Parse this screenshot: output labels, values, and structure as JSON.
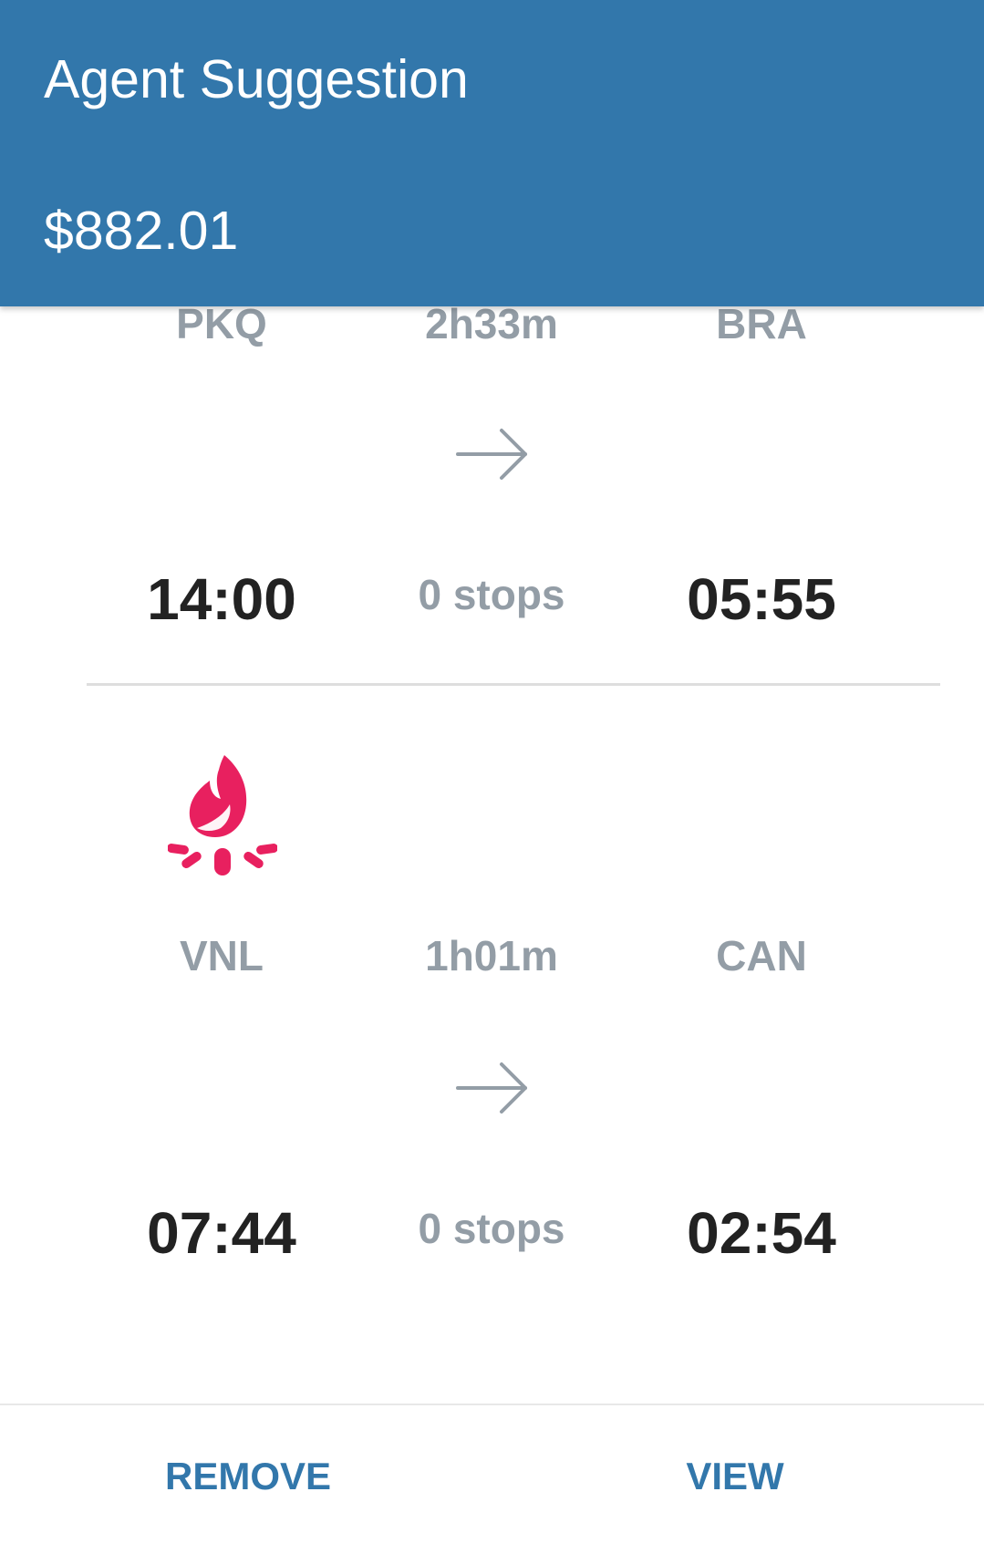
{
  "header": {
    "title": "Agent Suggestion",
    "price": "$882.01"
  },
  "legs": [
    {
      "origin": "PKQ",
      "duration": "2h33m",
      "destination": "BRA",
      "depart_time": "14:00",
      "stops": "0 stops",
      "arrive_time": "05:55",
      "arrow_icon": "arrow-right-icon"
    },
    {
      "airline_icon": "campfire-icon",
      "origin": "VNL",
      "duration": "1h01m",
      "destination": "CAN",
      "depart_time": "07:44",
      "stops": "0 stops",
      "arrive_time": "02:54",
      "arrow_icon": "arrow-right-icon"
    }
  ],
  "actions": {
    "remove_label": "REMOVE",
    "view_label": "VIEW"
  },
  "colors": {
    "header_bg": "#3277ab",
    "accent": "#3277ab",
    "airline_logo": "#e8205f",
    "muted_text": "#939da6",
    "primary_text": "#222222"
  }
}
